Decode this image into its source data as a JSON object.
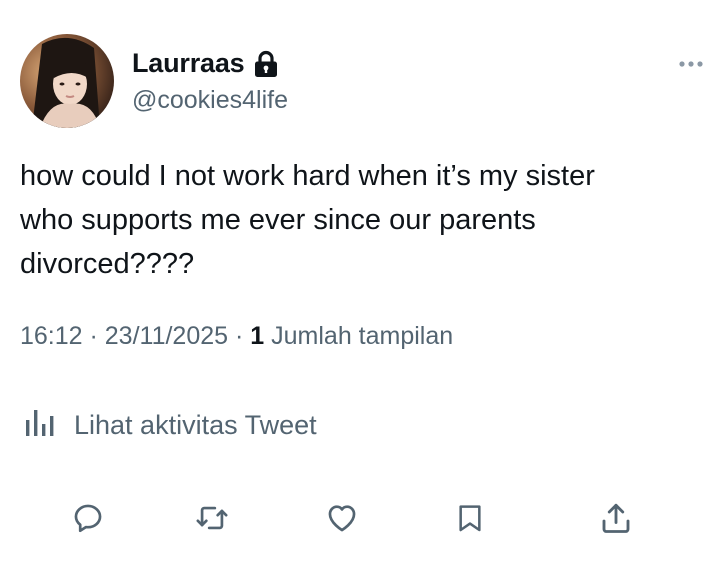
{
  "author": {
    "display_name": "Laurraas",
    "handle": "@cookies4life",
    "avatar_icon": "avatar-photo",
    "protected_icon": "lock-icon"
  },
  "tweet": {
    "text": "how could I not work hard when it’s my sister\nwho supports me ever since our parents\ndivorced????",
    "time": "16:12",
    "separator": " · ",
    "date": "23/11/2025",
    "views_count": "1",
    "views_label": "Jumlah tampilan"
  },
  "activity": {
    "label": "Lihat aktivitas Tweet",
    "icon": "analytics-icon"
  },
  "actions": {
    "icons": [
      "reply-icon",
      "retweet-icon",
      "like-icon",
      "bookmark-icon",
      "share-icon"
    ]
  },
  "colors": {
    "text_primary": "#0f1419",
    "text_secondary": "#536471",
    "icon": "#536471"
  }
}
